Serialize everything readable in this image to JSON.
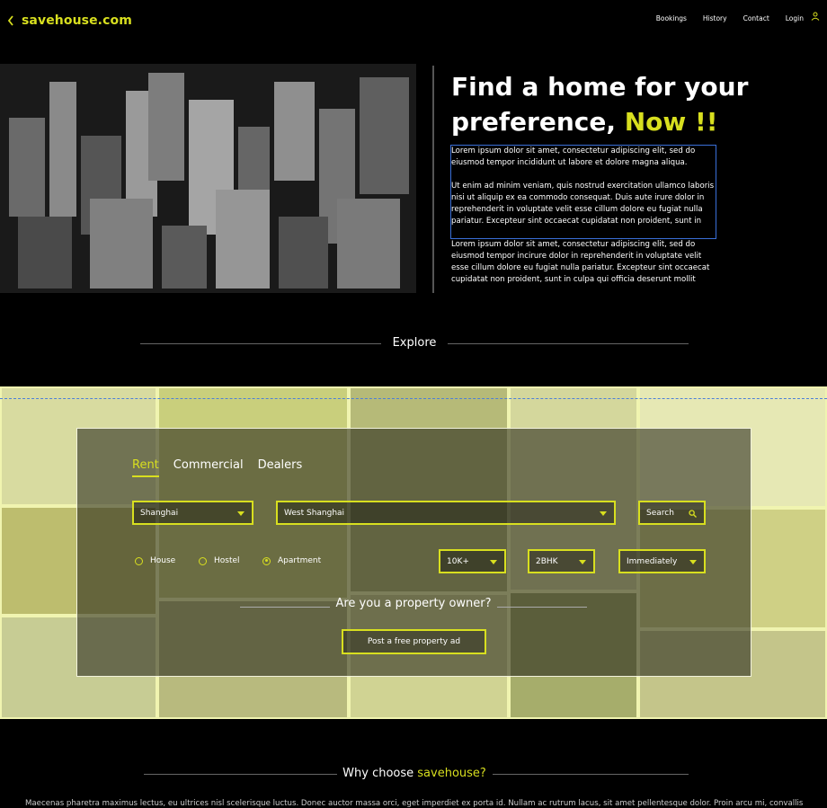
{
  "brand": {
    "name": "savehouse.com",
    "back_icon": "chevron-left-icon"
  },
  "nav": {
    "items": [
      "Bookings",
      "History",
      "Contact",
      "Login"
    ],
    "user_icon": "user-icon"
  },
  "hero": {
    "title_main": "Find a home for your preference,",
    "title_highlight": "Now !!",
    "paragraph_1": "Lorem ipsum dolor sit amet, consectetur adipiscing elit, sed do eiusmod tempor incididunt ut labore et dolore magna aliqua.",
    "paragraph_2": "Ut enim ad minim veniam, quis nostrud exercitation ullamco laboris nisi ut aliquip ex ea commodo consequat. Duis aute irure dolor in reprehenderit in voluptate velit esse cillum dolore eu fugiat nulla pariatur. Excepteur sint occaecat cupidatat non proident, sunt in",
    "paragraph_3": "Lorem ipsum dolor sit amet, consectetur adipiscing elit, sed do eiusmod tempor incirure dolor in reprehenderit in voluptate velit esse cillum dolore eu fugiat nulla pariatur. Excepteur sint occaecat cupidatat non proident, sunt in culpa qui officia deserunt mollit"
  },
  "explore": {
    "heading": "Explore"
  },
  "search": {
    "tabs": [
      "Rent",
      "Commercial",
      "Dealers"
    ],
    "active_tab": "Rent",
    "city": "Shanghai",
    "locality": "West Shanghai",
    "search_label": "Search",
    "property_types": [
      "House",
      "Hostel",
      "Apartment"
    ],
    "selected_type": "Apartment",
    "budget": "10K+",
    "bhk": "2BHK",
    "availability": "Immediately",
    "owner_question": "Are you a property owner?",
    "post_ad_label": "Post a free property ad"
  },
  "why": {
    "heading_prefix": "Why choose",
    "heading_brand": "savehouse?",
    "text": "Maecenas pharetra maximus lectus, eu ultrices nisl scelerisque luctus. Donec auctor massa orci, eget imperdiet ex porta id. Nullam ac rutrum lacus, sit amet pellentesque dolor. Proin arcu mi, convallis"
  },
  "colors": {
    "accent": "#d8df1f",
    "background": "#000000",
    "selection": "#3a6fd8"
  }
}
